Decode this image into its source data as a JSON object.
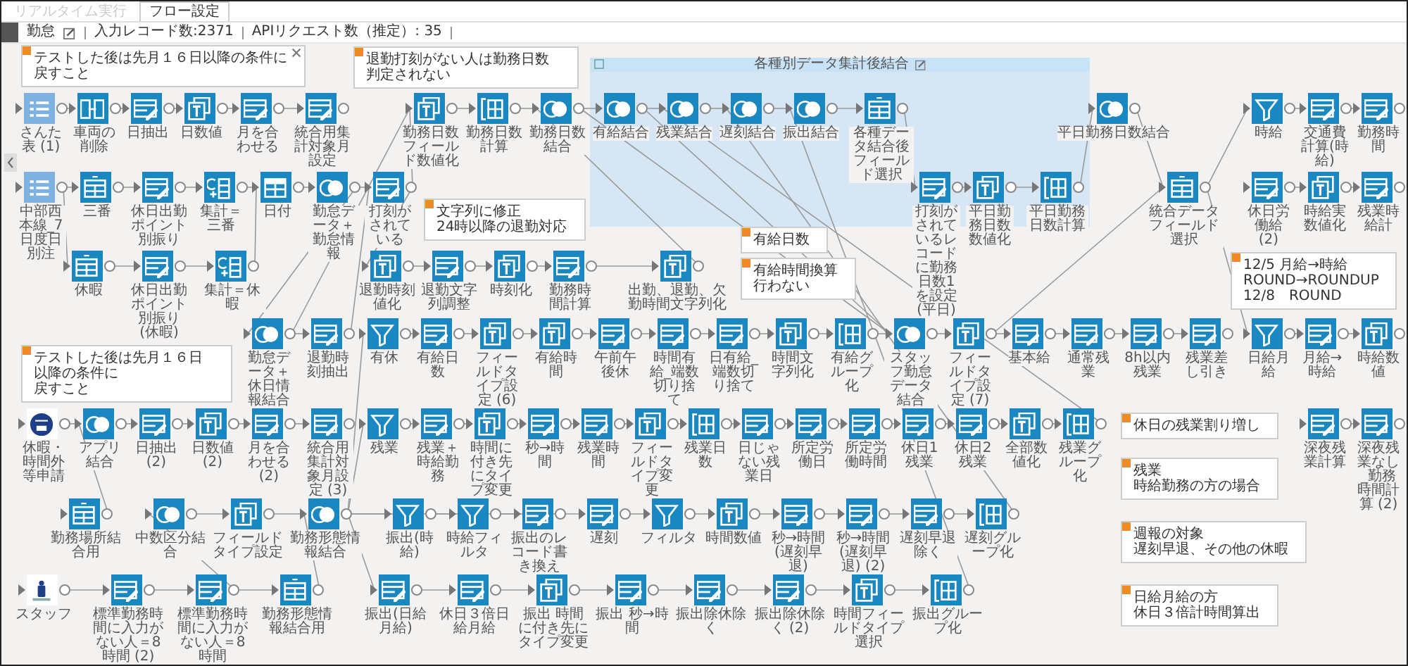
{
  "tabs": [
    {
      "label": "リアルタイム実行",
      "selected": false
    },
    {
      "label": "フロー設定",
      "selected": true
    }
  ],
  "info_bar": {
    "flow_name": "勤怠",
    "input_records": "入力レコード数:2371",
    "api_requests": "APIリクエスト数（推定）: 35"
  },
  "region": {
    "title": "各種別データ集計後結合"
  },
  "notes": [
    {
      "lines": [
        "テストした後は先月１６日以降の条件に",
        "戻すこと"
      ],
      "closable": true
    },
    {
      "lines": [
        "テストした後は先月１６日以降の条件に",
        "戻すこと"
      ],
      "closable": false
    },
    {
      "lines": [
        "退勤打刻がない人は勤務日数判定されない"
      ],
      "closable": false
    },
    {
      "lines": [
        "文字列に修正",
        "24時以降の退勤対応"
      ],
      "closable": false
    },
    {
      "lines": [
        "有給日数"
      ],
      "closable": false
    },
    {
      "lines": [
        "有給時間換算",
        "行わない"
      ],
      "closable": false
    },
    {
      "lines": [
        "残業",
        "時給勤務の方の場合"
      ],
      "closable": false
    },
    {
      "lines": [
        "週報の対象",
        "遅刻早退、その他の休暇"
      ],
      "closable": false
    },
    {
      "lines": [
        "日給月給の方",
        "休日３倍計時間算出"
      ],
      "closable": false
    },
    {
      "lines": [
        "12/5 月給→時給",
        "ROUND→ROUNDUP",
        "12/8　ROUND"
      ],
      "closable": false
    },
    {
      "lines": [
        "休日の残業割り増し"
      ],
      "closable": false
    }
  ],
  "nodes": [
    {
      "kind": "list",
      "label": "さんた表 (1)"
    },
    {
      "kind": "merge",
      "label": "車両の削除"
    },
    {
      "kind": "calc",
      "label": "日抽出"
    },
    {
      "kind": "text",
      "label": "日数値"
    },
    {
      "kind": "calc",
      "label": "月を合わせる"
    },
    {
      "kind": "calc",
      "label": "統合用集計対象月設定"
    },
    {
      "kind": "list",
      "label": "中部西本線_7日度日別注"
    },
    {
      "kind": "select",
      "label": "三番"
    },
    {
      "kind": "calc",
      "label": "休日出勤ポイント別振り"
    },
    {
      "kind": "sort",
      "label": "集計＝三番"
    },
    {
      "kind": "layout",
      "label": "日付"
    },
    {
      "kind": "join",
      "label": "勤怠データ＋勤怠情報"
    },
    {
      "kind": "select",
      "label": "休暇"
    },
    {
      "kind": "calc",
      "label": "休日出勤ポイント別振り (休暇)"
    },
    {
      "kind": "sort",
      "label": "集計＝休暇"
    },
    {
      "kind": "join",
      "label": "勤怠データ＋休日情報結合"
    },
    {
      "kind": "calc",
      "label": "退勤時刻抽出"
    },
    {
      "kind": "logo",
      "label": "休暇・時間外等申請"
    },
    {
      "kind": "join",
      "label": "アプリ結合"
    },
    {
      "kind": "calc",
      "label": "日抽出 (2)"
    },
    {
      "kind": "text",
      "label": "日数値 (2)"
    },
    {
      "kind": "calc",
      "label": "月を合わせる (2)"
    },
    {
      "kind": "calc",
      "label": "統合用集計対象月設定 (3)"
    },
    {
      "kind": "select",
      "label": "勤務場所結合用"
    },
    {
      "kind": "join",
      "label": "中数区分結合"
    },
    {
      "kind": "text",
      "label": "フィールドタイプ設定"
    },
    {
      "kind": "join",
      "label": "勤務形態情報結合"
    },
    {
      "kind": "image",
      "label": "スタッフ"
    },
    {
      "kind": "calc",
      "label": "標準勤務時間に入力がない人＝8時間 (2)"
    },
    {
      "kind": "calc",
      "label": "標準勤務時間に入力がない人＝8時間"
    },
    {
      "kind": "select",
      "label": "勤務形態情報結合用"
    },
    {
      "kind": "calc",
      "label": "打刻がされている"
    },
    {
      "kind": "text",
      "label": "退勤時刻値化"
    },
    {
      "kind": "filter",
      "label": "有休"
    },
    {
      "kind": "text",
      "label": "勤務日数フィールド数値化"
    },
    {
      "kind": "group",
      "label": "勤務日数計算"
    },
    {
      "kind": "join",
      "label": "勤務日数結合"
    },
    {
      "kind": "join",
      "label": "有給結合"
    },
    {
      "kind": "join",
      "label": "残業結合"
    },
    {
      "kind": "join",
      "label": "遅刻結合"
    },
    {
      "kind": "join",
      "label": "振出結合"
    },
    {
      "kind": "select",
      "label": "各種データ結合後フィールド選択"
    },
    {
      "kind": "calc",
      "label": "退勤文字列調整"
    },
    {
      "kind": "text",
      "label": "時刻化"
    },
    {
      "kind": "calc",
      "label": "勤務時間計算"
    },
    {
      "kind": "text",
      "label": "出勤、退勤、欠勤時間文字列化"
    },
    {
      "kind": "calc",
      "label": "打刻がされているレコードに勤務日数1を設定 (平日)"
    },
    {
      "kind": "text",
      "label": "平日勤務日数数値化"
    },
    {
      "kind": "group",
      "label": "平日勤務日数計算"
    },
    {
      "kind": "join",
      "label": "平日勤務日数結合"
    },
    {
      "kind": "select",
      "label": "統合データフィールド選択"
    },
    {
      "kind": "filter",
      "label": "時給"
    },
    {
      "kind": "calc",
      "label": "交通費計算(時給)"
    },
    {
      "kind": "calc",
      "label": "勤務時間"
    },
    {
      "kind": "calc",
      "label": "休日労働給 (2)"
    },
    {
      "kind": "text",
      "label": "時給実数値化"
    },
    {
      "kind": "calc",
      "label": "残業時給計"
    },
    {
      "kind": "calc",
      "label": "有給日数"
    },
    {
      "kind": "text",
      "label": "フィールドタイプ設定 (6)"
    },
    {
      "kind": "text",
      "label": "有給時間"
    },
    {
      "kind": "calc",
      "label": "午前午後休"
    },
    {
      "kind": "calc",
      "label": "時間有給_端数切り捨て"
    },
    {
      "kind": "calc",
      "label": "日有給_端数切り捨て"
    },
    {
      "kind": "text",
      "label": "時間文字列化"
    },
    {
      "kind": "group",
      "label": "有給グループ化"
    },
    {
      "kind": "join",
      "label": "スタッフ勤怠データ結合"
    },
    {
      "kind": "text",
      "label": "フィールドタイプ設定 (7)"
    },
    {
      "kind": "calc",
      "label": "基本給"
    },
    {
      "kind": "calc",
      "label": "通常残業"
    },
    {
      "kind": "calc",
      "label": "8h以内残業"
    },
    {
      "kind": "calc",
      "label": "残業差し引き"
    },
    {
      "kind": "filter",
      "label": "日給月給"
    },
    {
      "kind": "calc",
      "label": "月給→時給"
    },
    {
      "kind": "text",
      "label": "時給数値"
    },
    {
      "kind": "filter",
      "label": "残業"
    },
    {
      "kind": "calc",
      "label": "残業＋時給勤務"
    },
    {
      "kind": "text",
      "label": "時間に付き先にタイプ変更"
    },
    {
      "kind": "calc",
      "label": "秒→時間"
    },
    {
      "kind": "calc",
      "label": "残業時間"
    },
    {
      "kind": "text",
      "label": "フィールドタイプ変更"
    },
    {
      "kind": "group",
      "label": "残業日数"
    },
    {
      "kind": "calc",
      "label": "日じゃない残業日"
    },
    {
      "kind": "calc",
      "label": "所定労働日"
    },
    {
      "kind": "calc",
      "label": "所定労働時間"
    },
    {
      "kind": "calc",
      "label": "休日1残業"
    },
    {
      "kind": "calc",
      "label": "休日2残業"
    },
    {
      "kind": "text",
      "label": "全部数値化"
    },
    {
      "kind": "group",
      "label": "残業グループ化"
    },
    {
      "kind": "calc",
      "label": "深夜残業計算"
    },
    {
      "kind": "calc",
      "label": "深夜残業なし_勤務時間計算 (2)"
    },
    {
      "kind": "filter",
      "label": "振出(時給)"
    },
    {
      "kind": "filter",
      "label": "時給フィルタ"
    },
    {
      "kind": "calc",
      "label": "振出のレコード書き換え"
    },
    {
      "kind": "calc",
      "label": "遅刻"
    },
    {
      "kind": "filter",
      "label": "フィルタ"
    },
    {
      "kind": "text",
      "label": "時間数値"
    },
    {
      "kind": "calc",
      "label": "秒→時間(遅刻早退)"
    },
    {
      "kind": "calc",
      "label": "秒→時間(遅刻早退) (2)"
    },
    {
      "kind": "calc",
      "label": "遅刻早退除く"
    },
    {
      "kind": "group",
      "label": "遅刻グループ化"
    },
    {
      "kind": "calc",
      "label": "振出(日給月給)"
    },
    {
      "kind": "calc",
      "label": "休日３倍日給月給"
    },
    {
      "kind": "text",
      "label": "振出 時間に付き先にタイプ変更"
    },
    {
      "kind": "calc",
      "label": "振出 秒→時間"
    },
    {
      "kind": "calc",
      "label": "振出除休除く"
    },
    {
      "kind": "calc",
      "label": "振出除休除く (2)"
    },
    {
      "kind": "text",
      "label": "時間フィールドタイプ選択"
    },
    {
      "kind": "group",
      "label": "振出グループ化"
    }
  ]
}
